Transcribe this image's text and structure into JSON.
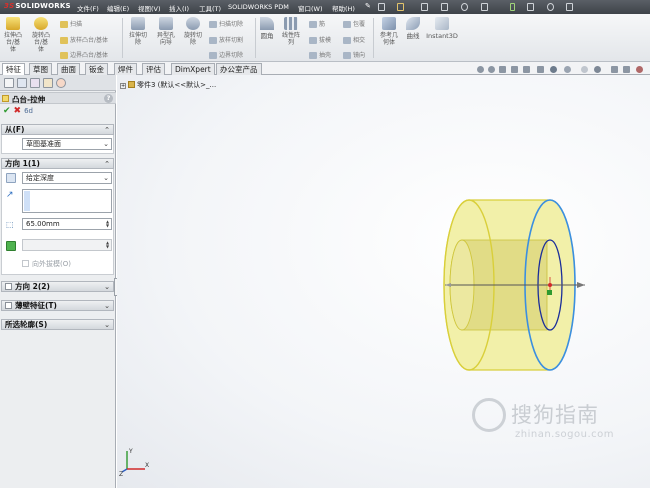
{
  "app": {
    "logo_text": "SOLIDWORKS",
    "logo_mark": "3S"
  },
  "menu": [
    "文件(F)",
    "编辑(E)",
    "视图(V)",
    "插入(I)",
    "工具(T)",
    "SOLIDWORKS PDM",
    "窗口(W)",
    "帮助(H)"
  ],
  "commands": {
    "extrude_boss": "拉伸凸\n台/基\n体",
    "revolve_boss": "旋转凸\n台/基\n体",
    "sweep": "扫描",
    "loft": "放样凸台/基体",
    "boundary": "边界凸台/基体",
    "extrude_cut": "拉伸切\n除",
    "hole_wizard": "异型孔\n向导",
    "revolve_cut": "旋转切\n除",
    "swept_cut": "扫描切除",
    "lofted_cut": "放样切割",
    "boundary_cut": "边界切除",
    "fillet": "圆角",
    "linear_pattern": "线性阵\n列",
    "rib": "筋",
    "draft": "拔模",
    "shell": "抽壳",
    "wrap": "包覆",
    "intersect": "相交",
    "mirror": "镜向",
    "ref_geometry": "参考几\n何体",
    "curves": "曲线",
    "instant3d": "Instant3D"
  },
  "tabs": [
    "特征",
    "草图",
    "曲面",
    "钣金",
    "焊件",
    "评估",
    "DimXpert",
    "办公室产品"
  ],
  "active_tab": 0,
  "property_manager": {
    "title": "凸台-拉伸",
    "help": "?",
    "from": {
      "label": "从(F)",
      "value": "草图基准面"
    },
    "direction1": {
      "label": "方向 1(1)",
      "end_condition": "给定深度",
      "depth": "65.00mm",
      "draft_outward": "向外拔模(O)"
    },
    "direction2": {
      "label": "方向 2(2)"
    },
    "thin_feature": {
      "label": "薄壁特征(T)"
    },
    "selected_contours": {
      "label": "所选轮廓(S)"
    }
  },
  "feature_tree": {
    "item": "零件3 (默认<<默认>_..."
  },
  "triad": {
    "x": "X",
    "y": "Y",
    "z": "Z"
  },
  "watermark": {
    "text": "搜狗指南",
    "url": "zhinan.sogou.com"
  },
  "colors": {
    "accent": "#2f7fd0",
    "extrude_preview": "#f3f0a0",
    "extrude_edge": "#d9cf3a",
    "sketch_edge": "#3b8fe0"
  }
}
